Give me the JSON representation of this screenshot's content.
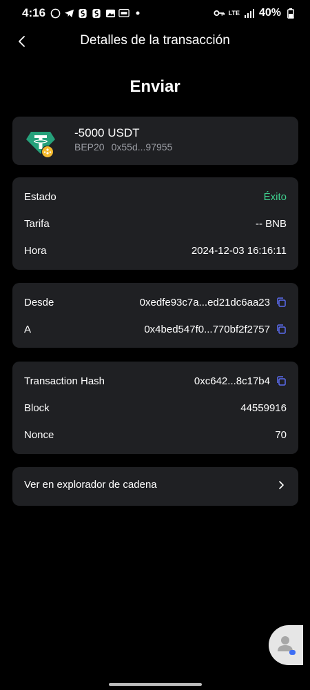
{
  "status_bar": {
    "time": "4:16",
    "network": "LTE",
    "battery": "40%"
  },
  "header": {
    "title": "Detalles de la transacción"
  },
  "page_title": "Enviar",
  "token": {
    "amount": "-5000 USDT",
    "network": "BEP20",
    "contract": "0x55d...97955"
  },
  "details": {
    "estado_label": "Estado",
    "estado_value": "Éxito",
    "tarifa_label": "Tarifa",
    "tarifa_value": "-- BNB",
    "hora_label": "Hora",
    "hora_value": "2024-12-03 16:16:11"
  },
  "addresses": {
    "desde_label": "Desde",
    "desde_value": "0xedfe93c7a...ed21dc6aa23",
    "a_label": "A",
    "a_value": "0x4bed547f0...770bf2f2757"
  },
  "chain": {
    "hash_label": "Transaction Hash",
    "hash_value": "0xc642...8c17b4",
    "block_label": "Block",
    "block_value": "44559916",
    "nonce_label": "Nonce",
    "nonce_value": "70"
  },
  "explorer": {
    "label": "Ver en explorador de cadena"
  },
  "colors": {
    "background": "#000000",
    "card": "#1f2023",
    "success": "#3fcf8e",
    "accent": "#5b6cf2",
    "tether": "#26a17b",
    "bnb_badge": "#f3ba2f"
  }
}
